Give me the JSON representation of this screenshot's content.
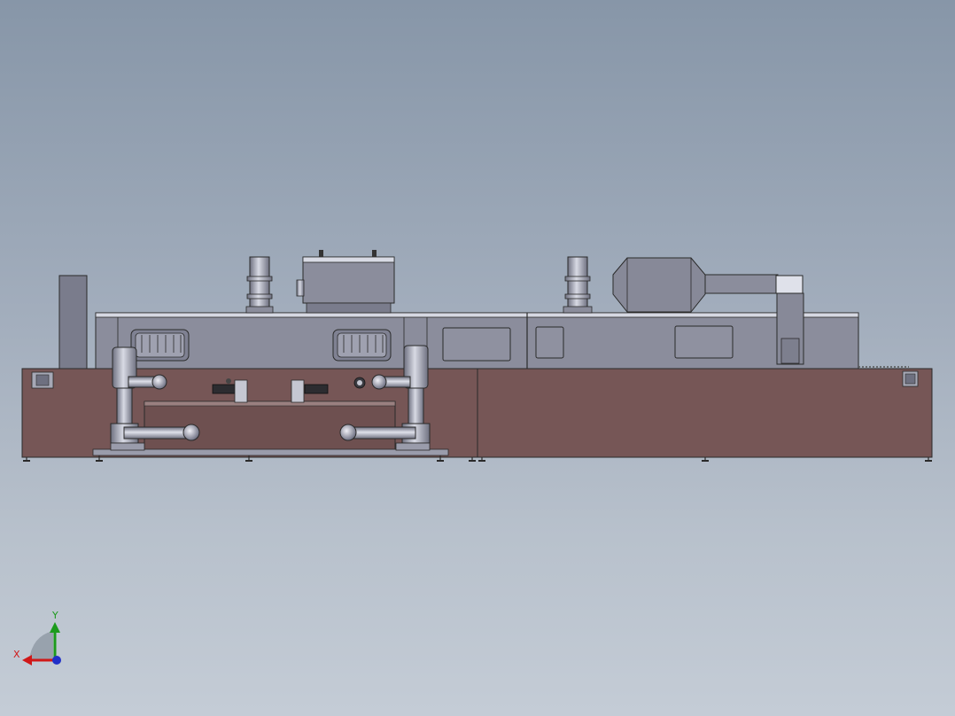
{
  "viewport": {
    "background_top": "#8796a8",
    "background_bottom": "#c4ccd6"
  },
  "model": {
    "base_color": "#765656",
    "panel_color": "#8b8d9c",
    "steel_color": "#7d7f90",
    "pipe_color": "#a9abb8"
  },
  "triad": {
    "x_label": "X",
    "y_label": "Y",
    "x_color": "#d01818",
    "y_color": "#1c9a1c",
    "z_color": "#2030c8"
  }
}
